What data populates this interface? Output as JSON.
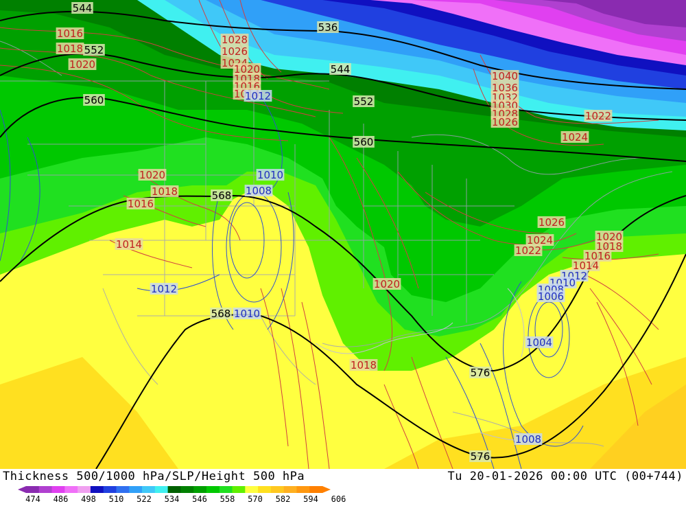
{
  "header": {
    "product": "Thickness 500/1000 hPa/SLP/Height 500 hPa",
    "valid_time": "Tu 20-01-2026 00:00 UTC (00+744)"
  },
  "legend": {
    "ticks": [
      "474",
      "486",
      "498",
      "510",
      "522",
      "534",
      "546",
      "558",
      "570",
      "582",
      "594",
      "606"
    ],
    "colors": [
      "#8a2bb0",
      "#b040d0",
      "#e040f0",
      "#f070f8",
      "#f0a0f0",
      "#1010c0",
      "#2040e0",
      "#3070f0",
      "#30a0f8",
      "#40c8f8",
      "#40f0f0",
      "#006000",
      "#008000",
      "#00a000",
      "#00c800",
      "#20e020",
      "#60f000",
      "#ffff40",
      "#ffe020",
      "#ffc820",
      "#ffb020",
      "#ff9810",
      "#ff8000"
    ]
  },
  "map": {
    "height_labels": [
      {
        "text": "544",
        "kind": "height"
      },
      {
        "text": "536",
        "kind": "height"
      },
      {
        "text": "552",
        "kind": "height"
      },
      {
        "text": "544",
        "kind": "height"
      },
      {
        "text": "552",
        "kind": "height"
      },
      {
        "text": "560",
        "kind": "height"
      },
      {
        "text": "560",
        "kind": "height"
      },
      {
        "text": "568",
        "kind": "height"
      },
      {
        "text": "576",
        "kind": "height"
      },
      {
        "text": "568",
        "kind": "height"
      },
      {
        "text": "576",
        "kind": "height"
      }
    ],
    "pressure_labels": [
      {
        "text": "1016"
      },
      {
        "text": "1018"
      },
      {
        "text": "1020"
      },
      {
        "text": "1028"
      },
      {
        "text": "1026"
      },
      {
        "text": "1024"
      },
      {
        "text": "1020"
      },
      {
        "text": "1018"
      },
      {
        "text": "1016"
      },
      {
        "text": "1014"
      },
      {
        "text": "1012"
      },
      {
        "text": "1040"
      },
      {
        "text": "1036"
      },
      {
        "text": "1032"
      },
      {
        "text": "1030"
      },
      {
        "text": "1028"
      },
      {
        "text": "1026"
      },
      {
        "text": "1022"
      },
      {
        "text": "1024"
      },
      {
        "text": "1020"
      },
      {
        "text": "1018"
      },
      {
        "text": "1016"
      },
      {
        "text": "1014"
      },
      {
        "text": "1010"
      },
      {
        "text": "1008"
      },
      {
        "text": "1012"
      },
      {
        "text": "1026"
      },
      {
        "text": "1024"
      },
      {
        "text": "1022"
      },
      {
        "text": "1020"
      },
      {
        "text": "1018"
      },
      {
        "text": "1016"
      },
      {
        "text": "1014"
      },
      {
        "text": "1012"
      },
      {
        "text": "1010"
      },
      {
        "text": "1008"
      },
      {
        "text": "1006"
      },
      {
        "text": "1020"
      },
      {
        "text": "1010"
      },
      {
        "text": "1018"
      },
      {
        "text": "1004"
      },
      {
        "text": "1008"
      }
    ]
  }
}
